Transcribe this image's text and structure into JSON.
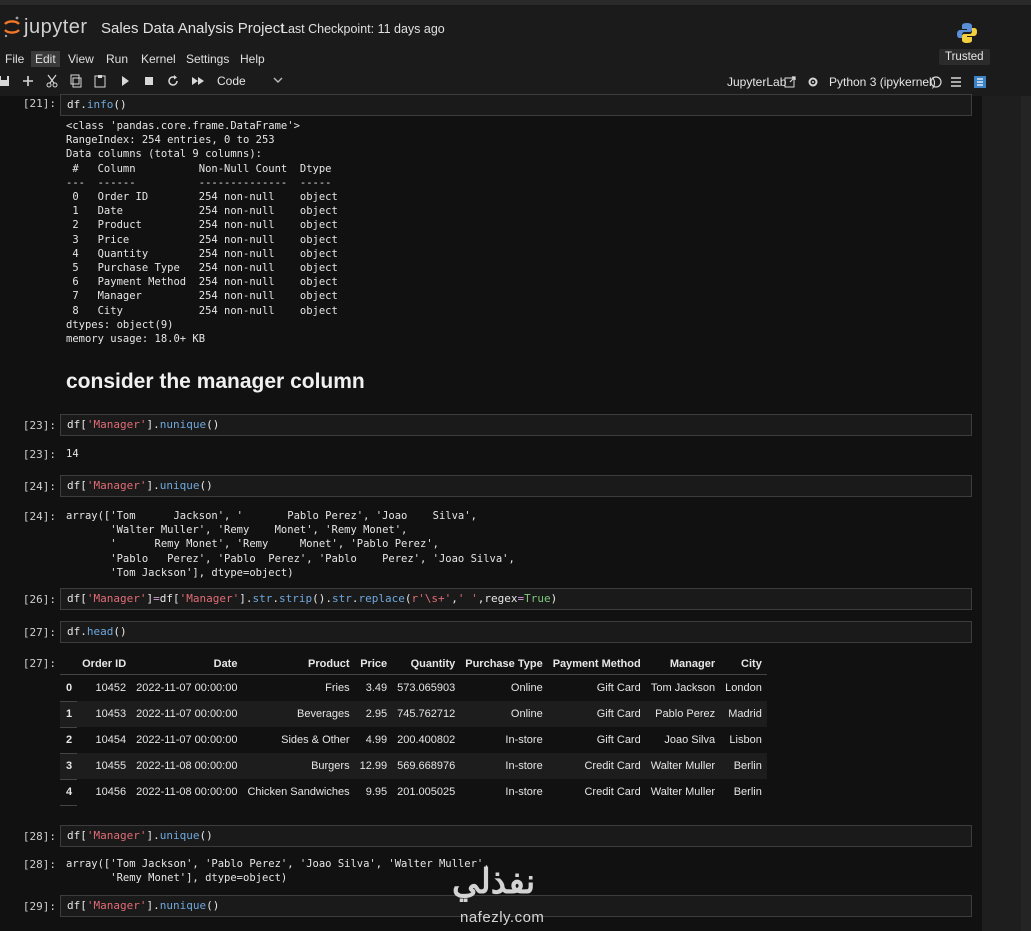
{
  "header": {
    "logo_text": "jupyter",
    "notebook_title": "Sales Data Analysis Project",
    "checkpoint": "Last Checkpoint: 11 days ago"
  },
  "menu": [
    "File",
    "Edit",
    "View",
    "Run",
    "Kernel",
    "Settings",
    "Help"
  ],
  "trusted": "Trusted",
  "toolbar": {
    "cell_type": "Code",
    "jupyterlab_label": "JupyterLab",
    "kernel_label": "Python 3 (ipykernel)",
    "icons": [
      "save-icon",
      "add-cell-icon",
      "cut-icon",
      "copy-icon",
      "paste-icon",
      "run-icon",
      "stop-icon",
      "restart-icon",
      "fast-forward-icon",
      "chevron-down-icon",
      "external-link-icon",
      "gear-icon",
      "kernel-status-circle-icon",
      "menu-icon",
      "notebook-icon"
    ]
  },
  "cells": {
    "c21": {
      "prompt_in": "[21]:",
      "code": {
        "a": "df.",
        "b": "info",
        "c": "()"
      },
      "output": "<class 'pandas.core.frame.DataFrame'>\nRangeIndex: 254 entries, 0 to 253\nData columns (total 9 columns):\n #   Column          Non-Null Count  Dtype \n---  ------          --------------  ----- \n 0   Order ID        254 non-null    object\n 1   Date            254 non-null    object\n 2   Product         254 non-null    object\n 3   Price           254 non-null    object\n 4   Quantity        254 non-null    object\n 5   Purchase Type   254 non-null    object\n 6   Payment Method  254 non-null    object\n 7   Manager         254 non-null    object\n 8   City            254 non-null    object\ndtypes: object(9)\nmemory usage: 18.0+ KB"
    },
    "markdown_heading": "consider the manager column",
    "c23": {
      "prompt_in": "[23]:",
      "prompt_out": "[23]:",
      "code": {
        "a": "df[",
        "s": "'Manager'",
        "b": "].",
        "m": "nunique",
        "c": "()"
      },
      "output": "14"
    },
    "c24": {
      "prompt_in": "[24]:",
      "prompt_out": "[24]:",
      "code": {
        "a": "df[",
        "s": "'Manager'",
        "b": "].",
        "m": "unique",
        "c": "()"
      },
      "output": "array(['Tom      Jackson', '       Pablo Perez', 'Joao    Silva',\n       'Walter Muller', 'Remy    Monet', 'Remy Monet',\n       '      Remy Monet', 'Remy     Monet', 'Pablo Perez',\n       'Pablo   Perez', 'Pablo  Perez', 'Pablo    Perez', 'Joao Silva',\n       'Tom Jackson'], dtype=object)"
    },
    "c26": {
      "prompt_in": "[26]:",
      "code": {
        "p1": "df[",
        "s1": "'Manager'",
        "p2": "]",
        "op": "=",
        "p3": "df[",
        "s2": "'Manager'",
        "p4": "].",
        "m1": "str",
        "p5": ".",
        "m2": "strip",
        "p6": "().",
        "m3": "str",
        "p7": ".",
        "m4": "replace",
        "p8": "(",
        "s3": "r'\\s+'",
        "p9": ",",
        "s4": "' '",
        "p10": ",regex",
        "op2": "=",
        "kw": "True",
        "p11": ")"
      }
    },
    "c27": {
      "prompt_in": "[27]:",
      "prompt_out": "[27]:",
      "code": {
        "a": "df.",
        "b": "head",
        "c": "()"
      }
    },
    "c28": {
      "prompt_in": "[28]:",
      "prompt_out": "[28]:",
      "code": {
        "a": "df[",
        "s": "'Manager'",
        "b": "].",
        "m": "unique",
        "c": "()"
      },
      "output": "array(['Tom Jackson', 'Pablo Perez', 'Joao Silva', 'Walter Muller',\n       'Remy Monet'], dtype=object)"
    },
    "c29": {
      "prompt_in": "[29]:",
      "code": {
        "a": "df[",
        "s": "'Manager'",
        "b": "].",
        "m": "nunique",
        "c": "()"
      }
    }
  },
  "dataframe": {
    "columns": [
      "",
      "Order ID",
      "Date",
      "Product",
      "Price",
      "Quantity",
      "Purchase Type",
      "Payment Method",
      "Manager",
      "City"
    ],
    "rows": [
      [
        "0",
        "10452",
        "2022-11-07 00:00:00",
        "Fries",
        "3.49",
        "573.065903",
        "Online",
        "Gift Card",
        "Tom Jackson",
        "London"
      ],
      [
        "1",
        "10453",
        "2022-11-07 00:00:00",
        "Beverages",
        "2.95",
        "745.762712",
        "Online",
        "Gift Card",
        "Pablo Perez",
        "Madrid"
      ],
      [
        "2",
        "10454",
        "2022-11-07 00:00:00",
        "Sides & Other",
        "4.99",
        "200.400802",
        "In-store",
        "Gift Card",
        "Joao Silva",
        "Lisbon"
      ],
      [
        "3",
        "10455",
        "2022-11-08 00:00:00",
        "Burgers",
        "12.99",
        "569.668976",
        "In-store",
        "Credit Card",
        "Walter Muller",
        "Berlin"
      ],
      [
        "4",
        "10456",
        "2022-11-08 00:00:00",
        "Chicken Sandwiches",
        "9.95",
        "201.005025",
        "In-store",
        "Credit Card",
        "Walter Muller",
        "Berlin"
      ]
    ]
  },
  "watermark": {
    "arabic": "نفذلي",
    "latin": "nafezly.com"
  }
}
